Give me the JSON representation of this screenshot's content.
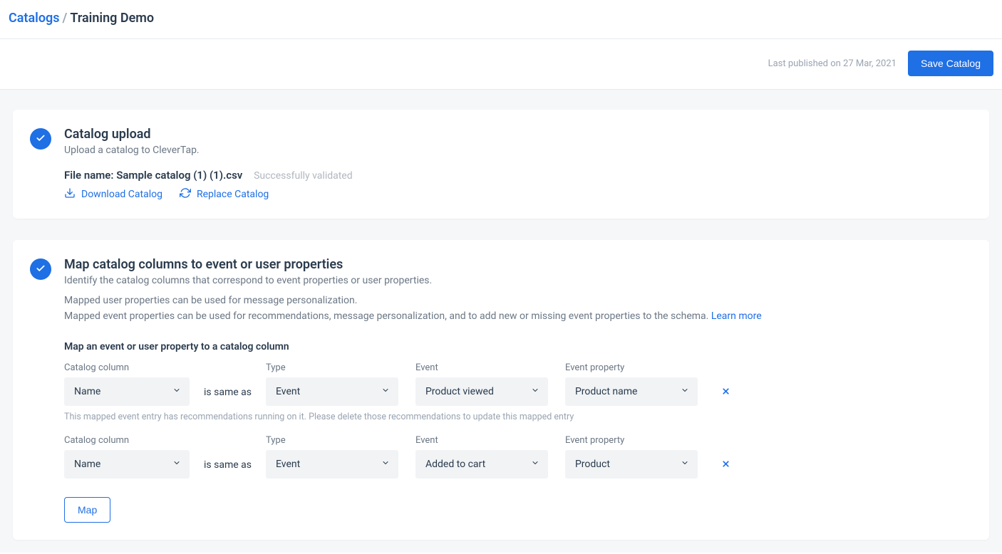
{
  "breadcrumb": {
    "root": "Catalogs",
    "current": "Training Demo"
  },
  "subheader": {
    "last_published": "Last published on 27 Mar, 2021",
    "save_label": "Save Catalog"
  },
  "upload_card": {
    "title": "Catalog upload",
    "desc": "Upload a catalog to CleverTap.",
    "filename_label": "File name:",
    "filename": "Sample catalog (1) (1).csv",
    "validated": "Successfully validated",
    "download": "Download Catalog",
    "replace": "Replace Catalog"
  },
  "map_card": {
    "title": "Map catalog columns to event or user properties",
    "desc": "Identify the catalog columns that correspond to event properties or user properties.",
    "p1": "Mapped user properties can be used for message personalization.",
    "p2": "Mapped event properties can be used for recommendations, message personalization, and to add new or missing event properties to the schema. ",
    "learn_more": "Learn more",
    "subtitle": "Map an event or user property to a catalog column",
    "labels": {
      "catalog_column": "Catalog column",
      "type": "Type",
      "event": "Event",
      "event_property": "Event property",
      "is_same_as": "is same as"
    },
    "rows": [
      {
        "catalog_column": "Name",
        "type": "Event",
        "event": "Product viewed",
        "event_property": "Product name",
        "warn": "This mapped event entry has recommendations running on it. Please delete those recommendations to update this mapped entry"
      },
      {
        "catalog_column": "Name",
        "type": "Event",
        "event": "Added to cart",
        "event_property": "Product",
        "warn": ""
      }
    ],
    "map_button": "Map"
  }
}
